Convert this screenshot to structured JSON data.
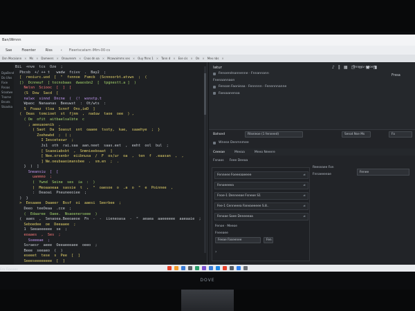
{
  "window": {
    "title": "Ban/Wrnnn"
  },
  "menubar": {
    "items": [
      "Sae",
      "Fioenter",
      "Riss"
    ],
    "url": "Fieeriscatarn iMm-00·cs"
  },
  "tabstrip": {
    "tabs": [
      "Dsn Mocaiann",
      "Ms",
      "Dameers",
      "Onaurenm",
      "Cnos dn oa",
      "Mcawaimms ses",
      "Ouy ffsns 1",
      "Tann d",
      "Ese cis",
      "On",
      "Mex nbs"
    ]
  },
  "sidebar": {
    "items": [
      "DgaBnnd",
      "Do Ulos",
      "Fixie",
      "Rnoas",
      "Sraatwe",
      "Tnarne",
      "Brcots",
      "Stoadsa"
    ]
  },
  "code_lines": [
    {
      "t": "BiL  +nve  tcs  Oze  ;",
      "c": "#c9ced4"
    },
    {
      "t": "  Pbcsb  +/ ++ t   wadw  fcivv  .  Bay2  ;",
      "c": "#c9ced4"
    },
    {
      "t": "  [  reoiurc.uod  [  \"  fxnnoe  Fsmcb  (Scnnoorbt.atvws  ;  (",
      "c": "#e6d46a"
    },
    {
      "t": "  [)  Dcnneuf  [ tocnsbaas  dwaosbn2  [  tpgnestt.a ]  )",
      "c": "#a7d86d"
    },
    {
      "t": "    Nelsn  Sciooc  [  ]  [",
      "c": "#ff7a7a"
    },
    {
      "t": "    (S  Dxw  Sacd  [",
      "c": "#e6d46a"
    },
    {
      "t": "    nalwx  sinnd  Dncne  (  (!  wsnxtp.t",
      "c": "#c49af5"
    },
    {
      "t": "    Wpaoc  Nanaanas  Beeuwst  :  Ot/wts  :",
      "c": "#c9ced4"
    },
    {
      "t": "    S  Foaaz  tloa  Scnnf  Ons,ieD  ]",
      "c": "#e6d46a"
    },
    {
      "t": "",
      "c": "#c9ced4"
    },
    {
      "t": "  (  Oeas  tomcioet  st  fjnm  ,  naduw  taoe  oee  ) ,",
      "c": "#e6d46a"
    },
    {
      "t": "    ( Oe  ofit  aitbaelsalbte  c",
      "c": "#a7d86d"
    },
    {
      "t": "      ; aeeuaoenib  ,",
      "c": "#e6d46a"
    },
    {
      "t": "        ( Saot  Da  Soasut  snt  oaaee  tsoty,  kae,  saaehye  ;  }",
      "c": "#e6d46a"
    },
    {
      "t": "          Zxehewbd  ;  ( ;",
      "c": "#e6d46a"
    },
    {
      "t": "            I Iesceteswr  ;",
      "c": "#e6d46a"
    },
    {
      "t": "            Js1  oth  rai.saa  aan.neet  saas.eet  ,  eeht  ool  bul  ;",
      "c": "#c9ced4"
    },
    {
      "t": "            [ Ssaoeiabsbt  ,  Snmnieeboaat  ]",
      "c": "#e6d46a"
    },
    {
      "t": "            [ Nee.orsenbr  eiibnusa  /  F  os/ur  oa  ,  ten  f  .eaasan  ,  ,",
      "c": "#e6d46a"
    },
    {
      "t": "            ] Ne.oeubaaoimansbee  .  sm.en  ;  .",
      "c": "#e6d46a"
    },
    {
      "t": "    }  )  ]",
      "c": "#c9ced4"
    },
    {
      "t": "      Sneansiu  [  [",
      "c": "#c49af5"
    },
    {
      "t": "        uanmno  ;",
      "c": "#ff7a7a"
    },
    {
      "t": "        (  Ywnd  Seine  ses  ia  :  )",
      "c": "#a7d86d"
    },
    {
      "t": "        )  Meoaaoeaa  sassie  t  ,  \"  oaesoe  o  .a  o  \"  e  Poinnee  ,",
      "c": "#e6d46a"
    },
    {
      "t": "        :  Deaoai  Pneuneeoiee  ;",
      "c": "#c9ced4"
    },
    {
      "t": "  )  }",
      "c": "#c9ced4"
    },
    {
      "t": "  >  Eesaaee  Daaeer  Bssf  oi  aaesi  Seerbee  ;",
      "c": "#e6d46a"
    },
    {
      "t": "    Deeo  teeOeaa  .cce  ;",
      "c": "#c9ced4"
    },
    {
      "t": "    (  Edaaree  Oaee.  Nsaoenerseee  )",
      "c": "#a7d86d"
    },
    {
      "t": "  (  aaes  ,  Senaoea.Beeoaeoe  Fn  -  -  iieneoasa  -  \"  aeaea  aaeeeeee  aaeaaie  ;  ;",
      "c": "#c9ced4"
    },
    {
      "t": "    Seboedee  oe  Deeaaee  ;",
      "c": "#e6d46a"
    },
    {
      "t": "    1  Seeaeeeeee  se  ;",
      "c": "#c9ced4"
    },
    {
      "t": "    eoaaes  ,  Ses  ;",
      "c": "#ff7a7a"
    },
    {
      "t": "      Sseeeae  ;",
      "c": "#c49af5"
    },
    {
      "t": "    Ssraesr  aeee  Oeeaeeeaee  oeeo  ;",
      "c": "#c9ced4"
    },
    {
      "t": "    Beee  seeaeo  (  )",
      "c": "#c9ced4"
    },
    {
      "t": "    eseeet  tese  s  Pee  [  ]",
      "c": "#e6d46a"
    },
    {
      "t": "    Seeeseeeeeeee  [  ]",
      "c": "#e6d46a"
    },
    {
      "t": "  (  )",
      "c": "#c9ced4"
    }
  ],
  "panel": {
    "title": "Iatur",
    "right_label": "Dnnnsv eeoerr",
    "small": "Frssa",
    "rows": [
      {
        "icon": true,
        "text": "Fenoendnannenne  ·  Fnnannann"
      },
      {
        "icon": false,
        "text": "Fnenaannaon"
      },
      {
        "icon": true,
        "text": "Fenoan  Faonieaa  ·  Fennnnn  ·  Fenennnanne"
      },
      {
        "icon": true,
        "text": "Faeoaanenoa"
      }
    ],
    "badge_label": "Bahsed",
    "field1": "Rtseieoe  (1  fenneed)",
    "field2": "Senat  Nse  Ms",
    "field3": "Fo",
    "subrow": "Wnese  Denmnmee"
  },
  "tabs2": [
    {
      "label": "Ceeeae",
      "active": true
    },
    {
      "label": "Meeaa",
      "active": false
    },
    {
      "label": "Meeo  Neeere",
      "active": false
    }
  ],
  "sub": [
    "Fsnaos",
    "Feee  Deeaa"
  ],
  "list": [
    {
      "text": "Fenneee  Foeeeaaeeee",
      "chk": "≠"
    },
    {
      "text": "Fenoeeeea",
      "chk": "≠"
    },
    {
      "text": "Fnoe-1      Denneeae  Fsneoe  S1",
      "chk": "≠"
    },
    {
      "text": "Fee-1      Cenneeea  Faneaeeeee  S.8..",
      "chk": "≠"
    },
    {
      "text": "Fenoae  Saee  Deneeeaa",
      "chk": "≠"
    }
  ],
  "list_extra": [
    {
      "text": "Fenoe  ·  Meeoe"
    },
    {
      "text": "Fneeaee"
    }
  ],
  "list_field": "Feeae  Faseenee",
  "list_field2": "Fen",
  "side2": {
    "top_label": "Reeseaee  Fon",
    "sub_label": "Fnnaeeeeae",
    "box_label": "Fenee"
  },
  "status": {
    "left": "Ero Fieeaes"
  },
  "monitor": {
    "brand": "DOVE"
  },
  "taskbar_colors": [
    "#e7402a",
    "#f39a2a",
    "#3a7bd5",
    "#5b5f66",
    "#2a9d6a",
    "#7a4fd0",
    "#3a7bd5",
    "#1e88e5",
    "#e7402a",
    "#555b63",
    "#2f80ed",
    "#6a6f76"
  ]
}
